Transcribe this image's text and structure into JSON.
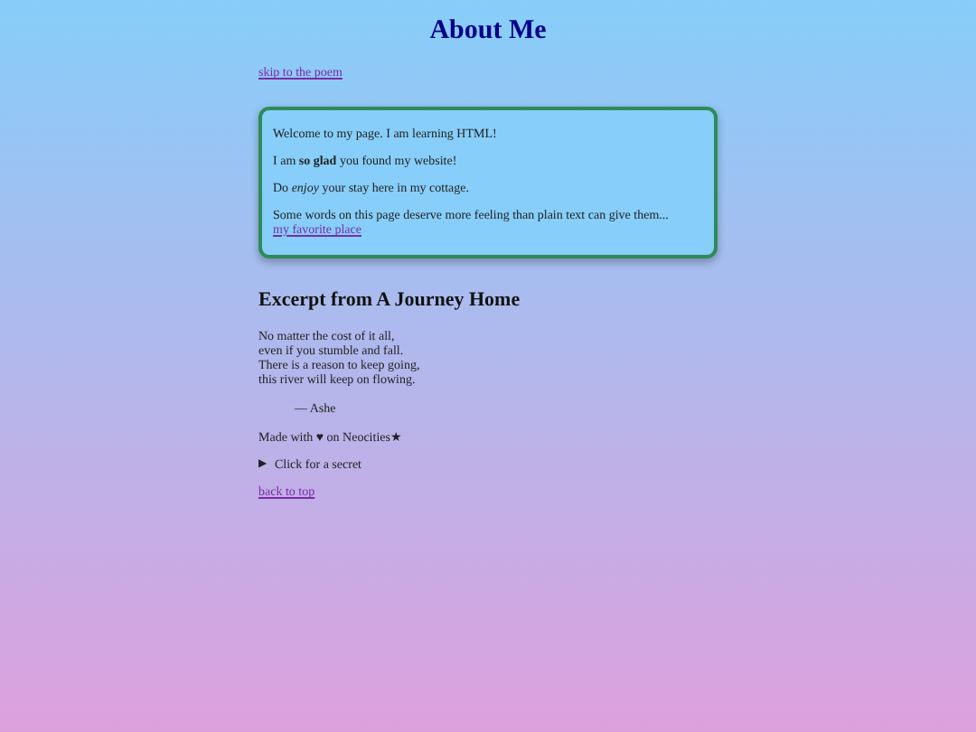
{
  "title": "About Me",
  "skip_link": "skip to the poem",
  "card": {
    "paragraphs": [
      "Welcome to my page. I am learning HTML!",
      "I am **so glad** you found my website!",
      "Do *enjoy* your stay here in my cottage.",
      "Some words on this page deserve more feeling than plain text can give them..."
    ],
    "link": "my favorite place"
  },
  "poem": {
    "heading": "Excerpt from A Journey Home",
    "lines": [
      "No matter the cost of it all,",
      "even if you stumble and fall.",
      "There is a reason to keep going,",
      "this river will keep on flowing."
    ],
    "attribution": "— Ashe"
  },
  "footer_note": "Made with ♥ on Neocities★",
  "secret": {
    "marker": "▶",
    "summary": "Click for a secret",
    "expanded": false
  },
  "back_link": "back to top"
}
